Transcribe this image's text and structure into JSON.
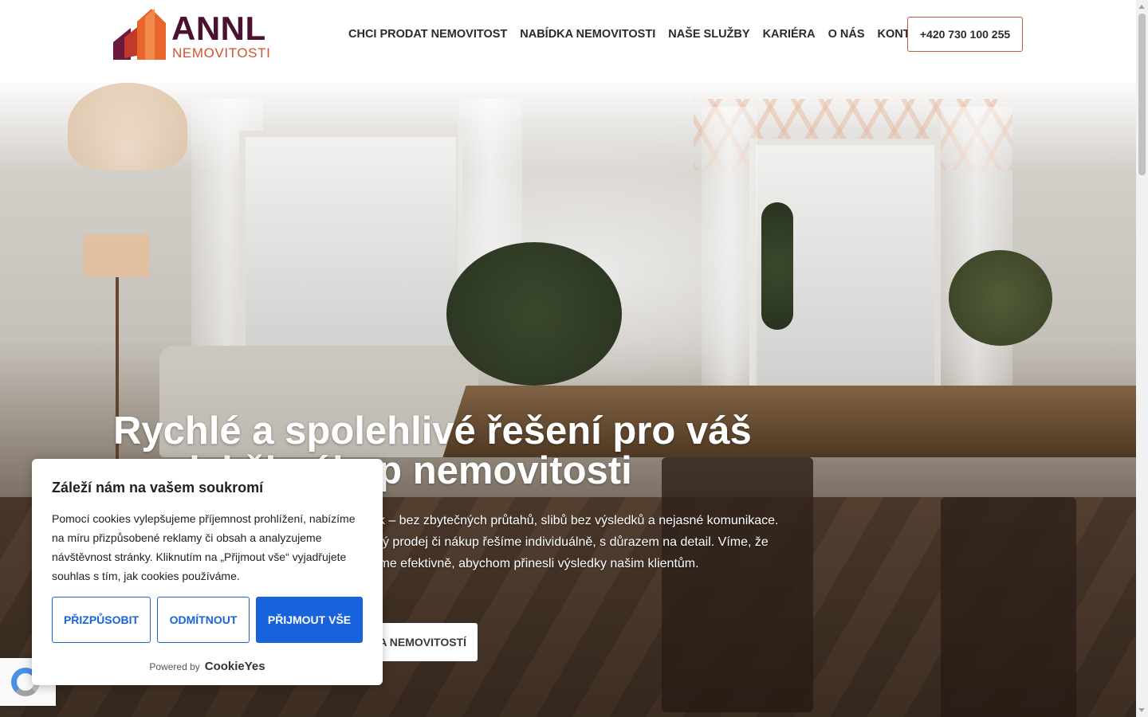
{
  "brand": {
    "name": "ANNL",
    "sub": "NEMOVITOSTI",
    "colors": {
      "primary": "#4a1230",
      "accent": "#d8502a"
    }
  },
  "nav": {
    "items": [
      {
        "label": "CHCI PRODAT NEMOVITOST"
      },
      {
        "label": "NABÍDKA NEMOVITOSTI"
      },
      {
        "label": "NAŠE SLUŽBY"
      },
      {
        "label": "KARIÉRA"
      },
      {
        "label": "O NÁS"
      },
      {
        "label": "KONTAKT"
      }
    ],
    "phone": "+420 730 100 255"
  },
  "hero": {
    "title": "Rychlé a spolehlivé řešení pro váš prodej či nákup nemovitosti",
    "text": "V ANNL Nemovitosti děláme realitní služby jinak – bez zbytečných průtahů, slibů bez výsledků a nejasné komunikace. Stavíme na odbornosti a férovém jednání. Každý prodej či nákup řešíme individuálně, s důrazem na detail. Víme, že čas hraje v realitách klíčovou roli, a proto jednáme efektivně, abychom přinesli výsledky našim klientům.",
    "cta": "NABÍDKA NEMOVITOSTÍ"
  },
  "cookie": {
    "title": "Záleží nám na vašem soukromí",
    "text": "Pomocí cookies vylepšujeme příjemnost prohlížení, nabízíme na míru přizpůsobené reklamy či obsah a analyzujeme návštěvnost stránky. Kliknutím na „Přijmout vše“ vyjadřujete souhlas s tím, jak cookies používáme.",
    "customize": "PŘIZPŮSOBIT",
    "reject": "ODMÍTNOUT",
    "accept": "PŘIJMOUT VŠE",
    "powered_by": "Powered by",
    "powered_logo": "CookieYes",
    "accent": "#1863dc"
  }
}
